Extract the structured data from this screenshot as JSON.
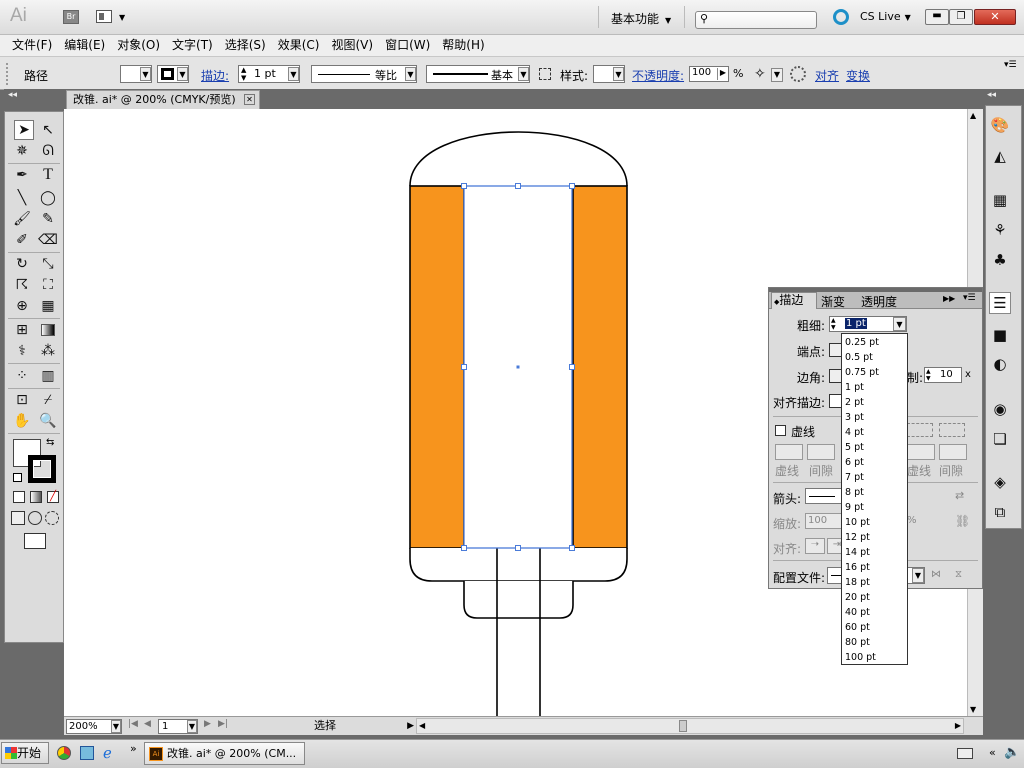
{
  "app": {
    "logo": "Ai",
    "bridge_btn": "Br",
    "workspace": "基本功能",
    "cs_live": "CS Live",
    "search_placeholder": ""
  },
  "menu": [
    "文件(F)",
    "编辑(E)",
    "对象(O)",
    "文字(T)",
    "选择(S)",
    "效果(C)",
    "视图(V)",
    "窗口(W)",
    "帮助(H)"
  ],
  "control_bar": {
    "object_type": "路径",
    "stroke_link": "描边:",
    "stroke_weight": "1 pt",
    "profile": "等比",
    "brush": "基本",
    "style_label": "样式:",
    "opacity_link": "不透明度:",
    "opacity_value": "100",
    "opacity_unit": "%",
    "align_link": "对齐",
    "transform_link": "变换"
  },
  "document": {
    "tab_title": "改锥. ai* @ 200% (CMYK/预览)",
    "zoom": "200%",
    "artboard": "1",
    "status": "选择"
  },
  "stroke_panel": {
    "tabs": [
      "描边",
      "渐变",
      "透明度"
    ],
    "weight_label": "粗细:",
    "weight_value": "1 pt",
    "cap_label": "端点:",
    "corner_label": "边角:",
    "limit_label": "制:",
    "limit_value": "10",
    "limit_unit": "x",
    "align_label": "对齐描边:",
    "dashed_label": "虚线",
    "dash_label_1": "虚线",
    "gap_label_1": "间隙",
    "dash_label_2": "虚线",
    "gap_label_2": "间隙",
    "arrow_label": "箭头:",
    "scale_label": "缩放:",
    "scale_value": "100",
    "scale_unit": "%",
    "align_arrow_label": "对齐:",
    "profile_label": "配置文件:"
  },
  "weight_options": [
    "0.25 pt",
    "0.5 pt",
    "0.75 pt",
    "1 pt",
    "2 pt",
    "3 pt",
    "4 pt",
    "5 pt",
    "6 pt",
    "7 pt",
    "8 pt",
    "9 pt",
    "10 pt",
    "12 pt",
    "14 pt",
    "16 pt",
    "18 pt",
    "20 pt",
    "40 pt",
    "60 pt",
    "80 pt",
    "100 pt"
  ],
  "taskbar": {
    "start": "开始",
    "window": "改锥. ai* @ 200% (CM..."
  },
  "colors": {
    "accent_orange": "#F7941D",
    "selection": "#4A7BD8"
  }
}
